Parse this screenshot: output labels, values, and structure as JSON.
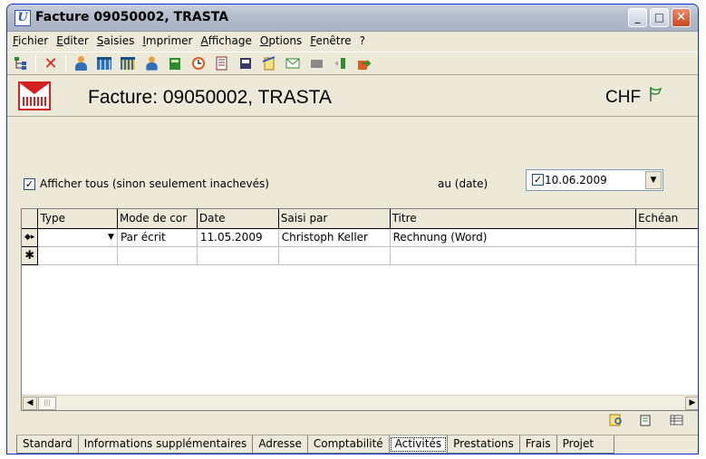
{
  "window": {
    "title": "Facture 09050002, TRASTA",
    "app_icon_letter": "U",
    "minimize_glyph": "_",
    "maximize_glyph": "□",
    "close_glyph": "✕"
  },
  "menu": [
    "Fichier",
    "Editer",
    "Saisies",
    "Imprimer",
    "Affichage",
    "Options",
    "Fenêtre",
    "?"
  ],
  "toolbar": {
    "icons": [
      "tree-icon",
      "delete-icon",
      "person-icon",
      "building-icon",
      "buildings-icon",
      "contact-icon",
      "book-icon",
      "clock-icon",
      "invoice-icon",
      "printer-icon",
      "notes-icon",
      "email-icon",
      "gray-block-icon",
      "move-icon",
      "export-icon"
    ]
  },
  "header": {
    "title": "Facture: 09050002, TRASTA",
    "currency": "CHF"
  },
  "filter": {
    "show_all_label": "Afficher tous (sinon seulement inachevés)",
    "show_all_checked": true,
    "date_label": "au (date)",
    "date_value": "10.06.2009",
    "date_checked": true
  },
  "grid": {
    "columns": [
      "Type",
      "Mode de cor",
      "Date",
      "Saisi par",
      "Titre",
      "Echéan"
    ],
    "rows": [
      {
        "marker": "◆▸",
        "type": "",
        "mode": "Par écrit",
        "date": "11.05.2009",
        "saisi_par": "Christoph Keller",
        "titre": "Rechnung (Word)",
        "echeance": ""
      }
    ],
    "new_row_marker": "✱"
  },
  "tabs": [
    "Standard",
    "Informations supplémentaires",
    "Adresse",
    "Comptabilité",
    "Activités",
    "Prestations",
    "Frais",
    "Projet"
  ],
  "active_tab": "Activités",
  "colors": {
    "title_bar": "#b3bccb",
    "window_bg": "#ece9d8",
    "close_button": "#c8461f",
    "accent_red": "#d42020",
    "flag_green": "#2d8c2d"
  }
}
